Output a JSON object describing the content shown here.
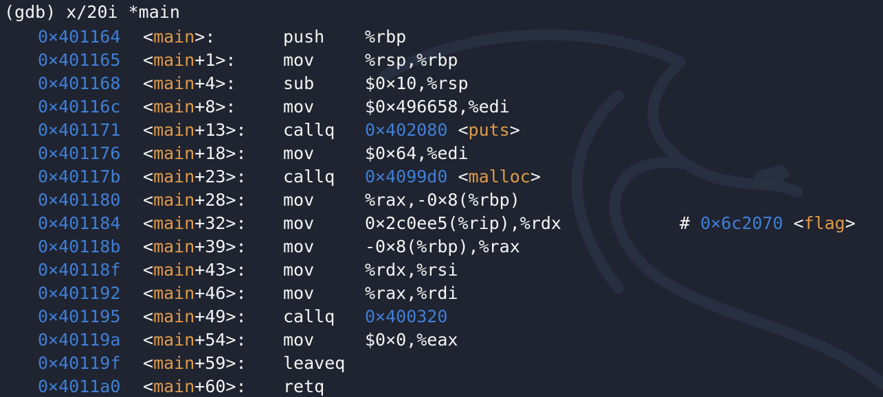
{
  "terminal": {
    "prompt": "(gdb) x/20i *main",
    "colors": {
      "background": "#1f2430",
      "address": "#3f7fd8",
      "symbol": "#e09a47",
      "text": "#f4f4f4"
    },
    "watermark_icon": "kali-dragon-icon",
    "rows": [
      {
        "addr": "0×401164",
        "fn": "main",
        "off": ">:",
        "mnemonic": "push",
        "operands": "%rbp"
      },
      {
        "addr": "0×401165",
        "fn": "main",
        "off": "+1>:",
        "mnemonic": "mov",
        "operands": "%rsp,%rbp"
      },
      {
        "addr": "0×401168",
        "fn": "main",
        "off": "+4>:",
        "mnemonic": "sub",
        "operands": "$0×10,%rsp"
      },
      {
        "addr": "0×40116c",
        "fn": "main",
        "off": "+8>:",
        "mnemonic": "mov",
        "operands": "$0×496658,%edi"
      },
      {
        "addr": "0×401171",
        "fn": "main",
        "off": "+13>:",
        "mnemonic": "callq",
        "target": "0×402080",
        "target_fn": "puts"
      },
      {
        "addr": "0×401176",
        "fn": "main",
        "off": "+18>:",
        "mnemonic": "mov",
        "operands": "$0×64,%edi"
      },
      {
        "addr": "0×40117b",
        "fn": "main",
        "off": "+23>:",
        "mnemonic": "callq",
        "target": "0×4099d0",
        "target_fn": "malloc"
      },
      {
        "addr": "0×401180",
        "fn": "main",
        "off": "+28>:",
        "mnemonic": "mov",
        "operands": "%rax,-0×8(%rbp)"
      },
      {
        "addr": "0×401184",
        "fn": "main",
        "off": "+32>:",
        "mnemonic": "mov",
        "operands": "0×2c0ee5(%rip),%rdx",
        "comment_addr": "0×6c2070",
        "comment_fn": "flag"
      },
      {
        "addr": "0×40118b",
        "fn": "main",
        "off": "+39>:",
        "mnemonic": "mov",
        "operands": "-0×8(%rbp),%rax"
      },
      {
        "addr": "0×40118f",
        "fn": "main",
        "off": "+43>:",
        "mnemonic": "mov",
        "operands": "%rdx,%rsi"
      },
      {
        "addr": "0×401192",
        "fn": "main",
        "off": "+46>:",
        "mnemonic": "mov",
        "operands": "%rax,%rdi"
      },
      {
        "addr": "0×401195",
        "fn": "main",
        "off": "+49>:",
        "mnemonic": "callq",
        "target": "0×400320"
      },
      {
        "addr": "0×40119a",
        "fn": "main",
        "off": "+54>:",
        "mnemonic": "mov",
        "operands": "$0×0,%eax"
      },
      {
        "addr": "0×40119f",
        "fn": "main",
        "off": "+59>:",
        "mnemonic": "leaveq"
      },
      {
        "addr": "0×4011a0",
        "fn": "main",
        "off": "+60>:",
        "mnemonic": "retq"
      }
    ]
  }
}
